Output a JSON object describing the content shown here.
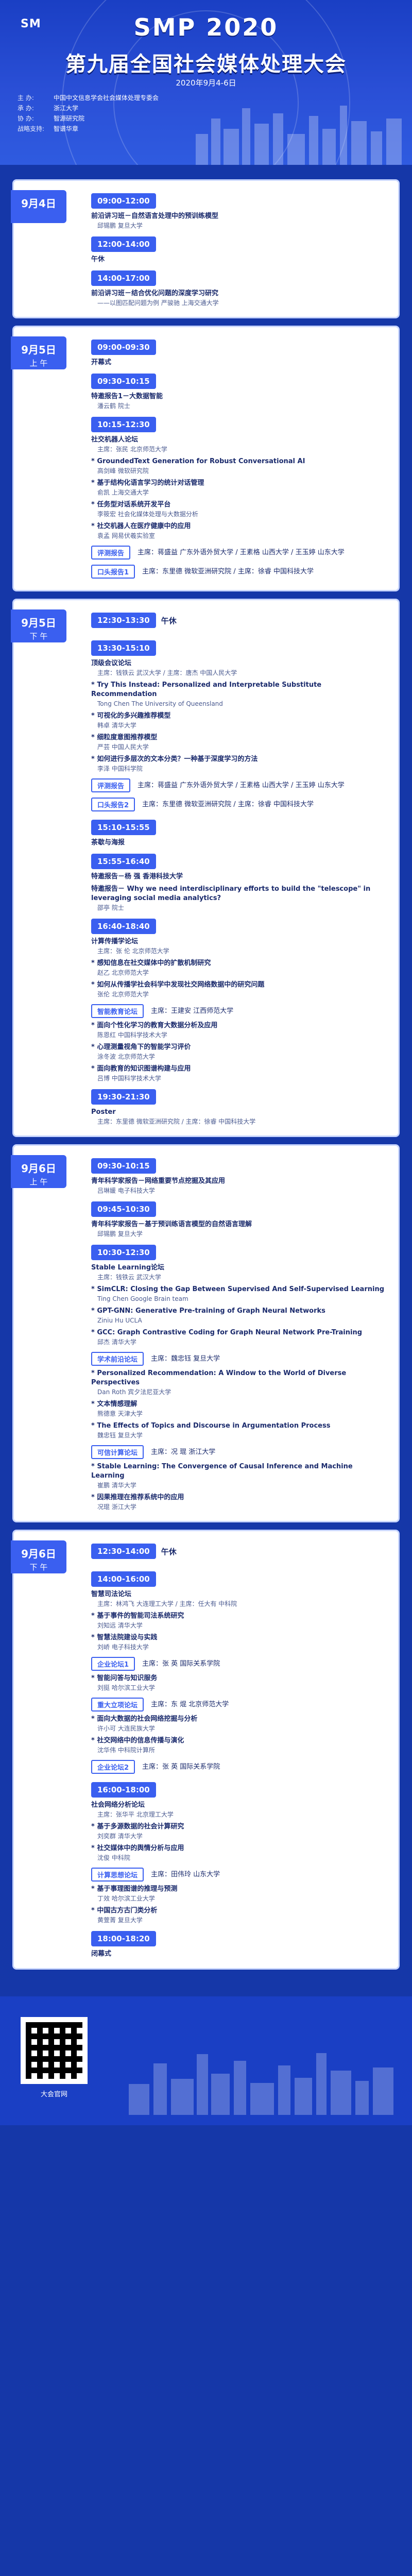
{
  "header": {
    "smp": "SMP 2020",
    "title": "第九届全国社会媒体处理大会",
    "date": "2020年9月4-6日",
    "org_items": [
      {
        "k": "主  办:",
        "v": "中国中文信息学会社会媒体处理专委会"
      },
      {
        "k": "承  办:",
        "v": "浙江大学"
      },
      {
        "k": "协  办:",
        "v": "智源研究院"
      },
      {
        "k": "战略支持:",
        "v": "智谱华章"
      }
    ]
  },
  "days": [
    {
      "day": "9月4日",
      "period": "",
      "blocks": [
        {
          "cap": "09:00-12:00",
          "text": "前沿讲习班－自然语言处理中的预训练模型",
          "sub": "邱锡鹏 复旦大学"
        },
        {
          "cap": "12:00-14:00",
          "text": "午休"
        },
        {
          "cap": "14:00-17:00",
          "text": "前沿讲习班－结合优化问题的深度学习研究",
          "sub": "——以图匹配问题为例 严骏驰 上海交通大学"
        }
      ]
    },
    {
      "day": "9月5日",
      "period": "上 午",
      "blocks": [
        {
          "cap": "09:00-09:30",
          "text": "开幕式"
        },
        {
          "cap": "09:30-10:15",
          "text": "特邀报告1－大数据智能",
          "sub": "潘云鹤 院士"
        },
        {
          "cap": "10:15-12:30",
          "text": "社交机器人论坛",
          "chairs": "主席：张民 北京师范大学"
        },
        {
          "text": "* GroundedText Generation for Robust Conversational AI",
          "sub": "高剑峰 微软研究院"
        },
        {
          "text": "* 基于结构化语言学习的统计对话管理",
          "sub": "俞凯 上海交通大学"
        },
        {
          "text": "* 任务型对话系统开发平台",
          "sub": "李筱宏 社会化媒体处理与大数据分析"
        },
        {
          "text": "* 社交机器人在医疗健康中的应用",
          "sub": "袁孟 网易伏羲实验室"
        },
        {
          "tag": "评测报告",
          "chairs": "主席：蒋盛益 广东外语外贸大学 / 王素格 山西大学 / 王玉婷 山东大学"
        },
        {
          "tag": "口头报告1",
          "chairs": "主席：东里德 微软亚洲研究院 / 主席：徐睿 中国科技大学"
        }
      ]
    },
    {
      "day": "9月5日",
      "period": "下 午",
      "topcap": "12:30-13:30",
      "toptext": "午休",
      "blocks": [
        {
          "cap": "13:30-15:10",
          "text": "顶级会议论坛",
          "chairs": "主席：钱铁云 武汉大学 / 主席：唐杰 中国人民大学"
        },
        {
          "text": "* Try This Instead: Personalized and Interpretable Substitute Recommendation",
          "sub": "Tong Chen The University of Queensland"
        },
        {
          "text": "* 可视化的多兴趣推荐模型",
          "sub": "韩卓 清华大学"
        },
        {
          "text": "* 细粒度意图推荐模型",
          "sub": "严芸 中国人民大学"
        },
        {
          "text": "* 如何进行多层次的文本分类？一种基于深度学习的方法",
          "sub": "李泽 中国科学院"
        },
        {
          "tag": "评测报告",
          "chairs": "主席：蒋盛益 广东外语外贸大学 / 王素格 山西大学 / 王玉婷 山东大学"
        },
        {
          "tag": "口头报告2",
          "chairs": "主席：东里德 微软亚洲研究院 / 主席：徐睿 中国科技大学"
        },
        {
          "cap": "15:10-15:55",
          "text": "茶歇与海报"
        },
        {
          "cap": "15:55-16:40",
          "text": "特邀报告－杨 强 香港科技大学"
        },
        {
          "text": "特邀报告－ Why we need interdisciplinary efforts to build the \"telescope\" in leveraging social media analytics?",
          "sub": "邵亭 院士"
        },
        {
          "cap": "16:40-18:40",
          "text": "计算传播学论坛",
          "chairs": "主席：张 伦 北京师范大学"
        },
        {
          "text": "* 感知信息在社交媒体中的扩散机制研究",
          "sub": "赵乙 北京师范大学"
        },
        {
          "text": "* 如何从传播学社会科学中发现社交网络数据中的研究问题",
          "sub": "张伦 北京师范大学"
        },
        {
          "tag": "智能教育论坛",
          "chairs": "主席：王建安 江西师范大学"
        },
        {
          "text": "* 面向个性化学习的教育大数据分析及应用",
          "sub": "陈恩红 中国科学技术大学"
        },
        {
          "text": "* 心理测量视角下的智能学习评价",
          "sub": "涂冬波 北京师范大学"
        },
        {
          "text": "* 面向教育的知识图谱构建与应用",
          "sub": "吕博 中国科学技术大学"
        },
        {
          "cap": "19:30-21:30",
          "text": "Poster",
          "chairs": "主席：东里德 微软亚洲研究院 / 主席：徐睿 中国科技大学"
        }
      ]
    },
    {
      "day": "9月6日",
      "period": "上 午",
      "blocks": [
        {
          "cap": "09:30-10:15",
          "text": "青年科学家报告－网络重要节点挖掘及其应用",
          "sub": "吕琳媛 电子科技大学"
        },
        {
          "cap": "09:45-10:30",
          "text": "青年科学家报告－基于预训练语言模型的自然语言理解",
          "sub": "邱锡鹏 复旦大学"
        },
        {
          "cap": "10:30-12:30",
          "text": "Stable Learning论坛",
          "chairs": "主席：钱铁云 武汉大学"
        },
        {
          "text": "* SimCLR: Closing the Gap Between Supervised And Self-Supervised Learning",
          "sub": "Ting Chen Google Brain team"
        },
        {
          "text": "* GPT-GNN: Generative Pre-training of Graph Neural Networks",
          "sub": "Ziniu Hu UCLA"
        },
        {
          "text": "* GCC: Graph Contrastive Coding for Graph Neural Network Pre-Training",
          "sub": "邱杰 清华大学"
        },
        {
          "tag": "学术前沿论坛",
          "chairs": "主席：魏忠钰 复旦大学"
        },
        {
          "text": "* Personalized Recommendation: A Window to the World of Diverse Perspectives",
          "sub": "Dan Roth 宾夕法尼亚大学"
        },
        {
          "text": "* 文本情感理解",
          "sub": "熊德意 天津大学"
        },
        {
          "text": "* The Effects of Topics and Discourse in Argumentation Process",
          "sub": "魏忠钰 复旦大学"
        },
        {
          "tag": "可信计算论坛",
          "chairs": "主席：况 琨 浙江大学"
        },
        {
          "text": "* Stable Learning: The Convergence of Causal Inference and Machine Learning",
          "sub": "崔鹏 清华大学"
        },
        {
          "text": "* 因果推理在推荐系统中的应用",
          "sub": "况琨 浙江大学"
        }
      ]
    },
    {
      "day": "9月6日",
      "period": "下 午",
      "topcap": "12:30-14:00",
      "toptext": "午休",
      "blocks": [
        {
          "cap": "14:00-16:00",
          "text": "智慧司法论坛",
          "chairs": "主席：林鸿飞 大连理工大学 / 主席：任大有 中科院"
        },
        {
          "text": "* 基于事件的智能司法系统研究",
          "sub": "刘知远 清华大学"
        },
        {
          "text": "* 智慧法院建设与实践",
          "sub": "刘峤 电子科技大学"
        },
        {
          "tag": "企业论坛1",
          "chairs": "主席：张 英 国际关系学院"
        },
        {
          "text": "* 智能问答与知识服务",
          "sub": "刘挺 哈尔滨工业大学"
        },
        {
          "tag": "重大立项论坛",
          "chairs": "主席：东 焜 北京师范大学"
        },
        {
          "text": "* 面向大数据的社会网络挖掘与分析",
          "sub": "许小可 大连民族大学"
        },
        {
          "text": "* 社交网络中的信息传播与演化",
          "sub": "沈华伟 中科院计算所"
        },
        {
          "tag": "企业论坛2",
          "chairs": "主席：张 英 国际关系学院"
        },
        {
          "cap": "16:00-18:00",
          "text": "社会网络分析论坛",
          "chairs": "主席：张华平 北京理工大学"
        },
        {
          "text": "* 基于多源数据的社会计算研究",
          "sub": "刘奕群 清华大学"
        },
        {
          "text": "* 社交媒体中的舆情分析与应用",
          "sub": "沈俊 中科院"
        },
        {
          "tag": "计算思想论坛",
          "chairs": "主席：田伟玲 山东大学"
        },
        {
          "text": "* 基于事理图谱的推理与预测",
          "sub": "丁效 哈尔滨工业大学"
        },
        {
          "text": "* 中国古方古门类分析",
          "sub": "黄萱菁 复旦大学"
        },
        {
          "cap": "18:00-18:20",
          "text": "闭幕式"
        }
      ]
    }
  ],
  "footer": {
    "qr_label": "大会官网"
  },
  "colors": {
    "primary": "#3a5ff0",
    "bg": "#1537a8"
  }
}
